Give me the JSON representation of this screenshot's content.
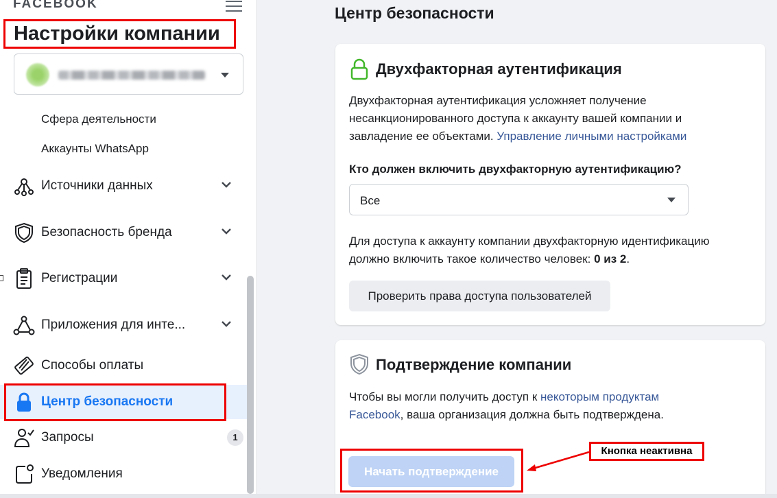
{
  "brand": {
    "logo": "FACEBOOK"
  },
  "sidebar": {
    "title": "Настройки компании",
    "business_selector": {
      "name_blurred": true
    },
    "sub_items": [
      {
        "label": "Сфера деятельности"
      },
      {
        "label": "Аккаунты WhatsApp"
      }
    ],
    "items": [
      {
        "label": "Источники данных",
        "icon": "data-sources-icon",
        "expandable": true
      },
      {
        "label": "Безопасность бренда",
        "icon": "shield-icon",
        "expandable": true
      },
      {
        "label": "Регистрации",
        "icon": "clipboard-icon",
        "expandable": true
      },
      {
        "label": "Приложения для инте...",
        "icon": "integrations-icon",
        "expandable": true
      },
      {
        "label": "Способы оплаты",
        "icon": "credit-card-icon",
        "expandable": false
      },
      {
        "label": "Центр безопасности",
        "icon": "lock-icon",
        "expandable": false,
        "active": true
      },
      {
        "label": "Запросы",
        "icon": "person-add-icon",
        "badge": "1"
      },
      {
        "label": "Уведомления",
        "icon": "notification-icon"
      }
    ]
  },
  "main": {
    "page_title": "Центр безопасности",
    "two_factor": {
      "title": "Двухфакторная аутентификация",
      "description": "Двухфакторная аутентификация усложняет получение несанкционированного доступа к аккаунту вашей компании и завладение ее объектами.",
      "link": "Управление личными настройками",
      "question": "Кто должен включить двухфакторную аутентификацию?",
      "select_value": "Все",
      "count_text": "Для доступа к аккаунту компании двухфакторную идентификацию должно включить такое количество человек:",
      "count_value": "0 из 2",
      "count_suffix": ".",
      "check_button": "Проверить права доступа пользователей"
    },
    "verification": {
      "title": "Подтверждение компании",
      "text_before": "Чтобы вы могли получить доступ к",
      "link": "некоторым продуктам Facebook",
      "text_after": ", ваша организация должна быть подтверждена.",
      "start_button": "Начать подтверждение",
      "start_button_disabled": true
    }
  },
  "annotation": {
    "label": "Кнопка неактивна"
  },
  "colors": {
    "accent": "#1877f2",
    "link": "#385898",
    "highlight": "#ee0000",
    "disabled_button": "#bed3f5"
  }
}
